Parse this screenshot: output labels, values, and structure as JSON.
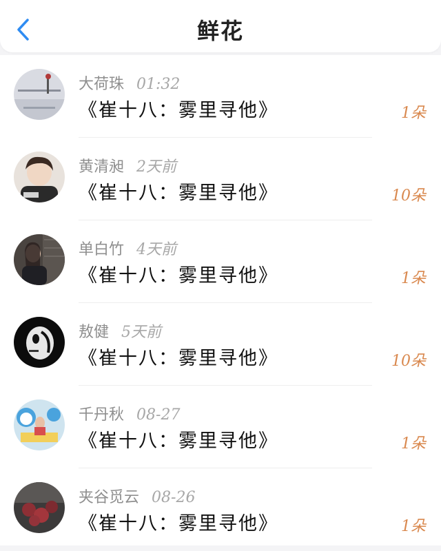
{
  "header": {
    "title": "鲜花"
  },
  "rows": [
    {
      "name": "大荷珠",
      "time": "01:32",
      "work": "《崔十八：雾里寻他》",
      "count": "1朵"
    },
    {
      "name": "黄清昶",
      "time": "2天前",
      "work": "《崔十八：雾里寻他》",
      "count": "10朵"
    },
    {
      "name": "单白竹",
      "time": "4天前",
      "work": "《崔十八：雾里寻他》",
      "count": "1朵"
    },
    {
      "name": "敖健",
      "time": "5天前",
      "work": "《崔十八：雾里寻他》",
      "count": "10朵"
    },
    {
      "name": "千丹秋",
      "time": "08-27",
      "work": "《崔十八：雾里寻他》",
      "count": "1朵"
    },
    {
      "name": "夹谷觅云",
      "time": "08-26",
      "work": "《崔十八：雾里寻他》",
      "count": "1朵"
    }
  ],
  "colors": {
    "accent": "#2f8cf2",
    "count": "#d9884e"
  }
}
